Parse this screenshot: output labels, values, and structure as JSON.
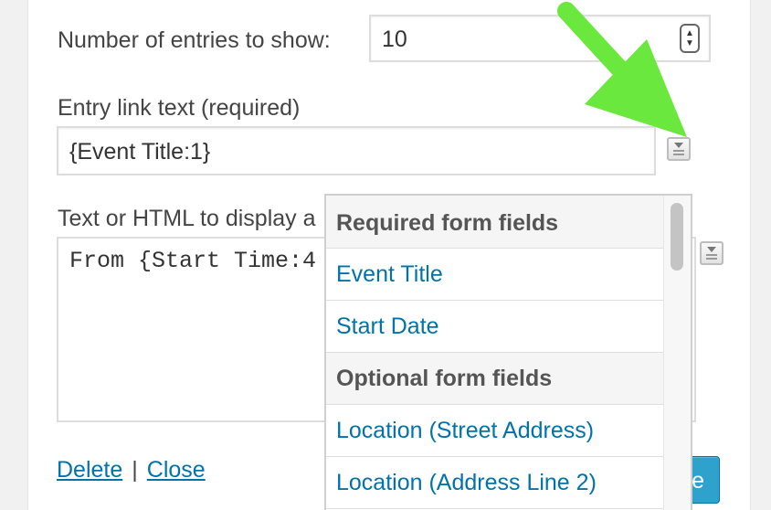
{
  "form": {
    "entries_label": "Number of entries to show:",
    "entries_value": "10",
    "link_text_label": "Entry link text (required)",
    "link_text_value": "{Event Title:1}",
    "display_label": "Text or HTML to display a",
    "display_value": "From {Start Time:4"
  },
  "footer": {
    "delete_label": "Delete",
    "separator": "|",
    "close_label": "Close",
    "save_label": "e"
  },
  "dropdown": {
    "items": [
      {
        "label": "Required form fields",
        "kind": "header"
      },
      {
        "label": "Event Title",
        "kind": "field"
      },
      {
        "label": "Start Date",
        "kind": "field"
      },
      {
        "label": "Optional form fields",
        "kind": "header"
      },
      {
        "label": "Location (Street Address)",
        "kind": "field"
      },
      {
        "label": "Location (Address Line 2)",
        "kind": "field"
      }
    ]
  },
  "icons": {
    "field_picker": "field-picker-icon",
    "spinner": "number-spinner-icon",
    "annotation_arrow": "arrow-icon"
  },
  "colors": {
    "link": "#0073aa",
    "primary_button": "#2ea2cc",
    "arrow": "#66e63a"
  }
}
